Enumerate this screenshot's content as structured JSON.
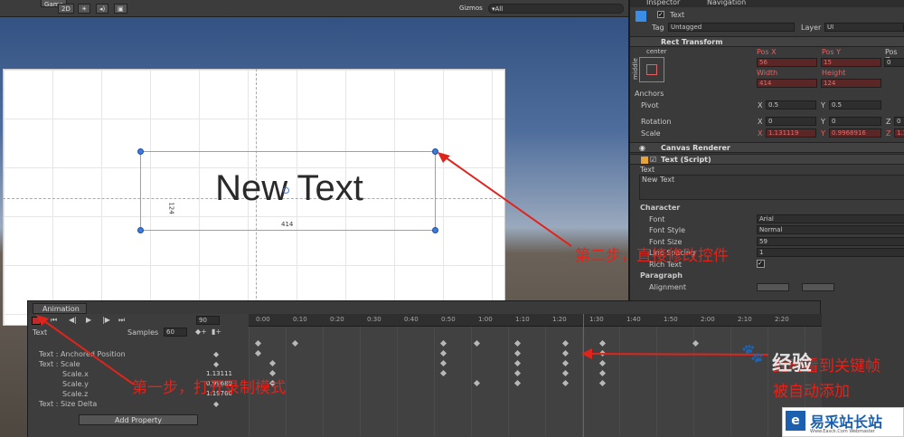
{
  "scene": {
    "tab": "Game",
    "mode": "2D",
    "gizmos": "Gizmos",
    "search": "▾All",
    "canvas_text": "New Text",
    "width_label": "414",
    "height_label": "124"
  },
  "inspector": {
    "tabs": [
      "Inspector",
      "Navigation"
    ],
    "object_name": "Text",
    "tag_label": "Tag",
    "tag": "Untagged",
    "layer_label": "Layer",
    "layer": "UI",
    "rect": {
      "title": "Rect Transform",
      "anchor_h": "center",
      "anchor_v": "middle",
      "pos_x_label": "Pos X",
      "pos_y_label": "Pos Y",
      "pos_z_label": "Pos Z",
      "pos_x": "56",
      "pos_y": "15",
      "pos_z": "0",
      "width_label": "Width",
      "height_label": "Height",
      "width": "414",
      "height": "124",
      "anchors": "Anchors",
      "pivot": "Pivot",
      "pivot_x": "0.5",
      "pivot_y": "0.5",
      "rotation": "Rotation",
      "rot_x": "0",
      "rot_y": "0",
      "rot_z": "0",
      "scale": "Scale",
      "scale_x": "1.131119",
      "scale_y": "0.9968916",
      "scale_z": "1.1"
    },
    "canvas_renderer": "Canvas Renderer",
    "text_script": {
      "title": "Text (Script)",
      "text_label": "Text",
      "text_value": "New Text",
      "character": "Character",
      "font": "Font",
      "font_value": "Arial",
      "font_style": "Font Style",
      "font_style_value": "Normal",
      "font_size": "Font Size",
      "font_size_value": "59",
      "line_spacing": "Line Spacing",
      "line_spacing_value": "1",
      "rich_text": "Rich Text",
      "paragraph": "Paragraph",
      "alignment": "Alignment"
    }
  },
  "animation": {
    "tab": "Animation",
    "frame": "90",
    "clip": "Text",
    "samples_label": "Samples",
    "samples": "60",
    "ticks": [
      "0:00",
      "0:10",
      "0:20",
      "0:30",
      "0:40",
      "0:50",
      "1:00",
      "1:10",
      "1:20",
      "1:30",
      "1:40",
      "1:50",
      "2:00",
      "2:10",
      "2:20"
    ],
    "properties": [
      {
        "name": "Text : Anchored Position",
        "value": ""
      },
      {
        "name": "Text : Scale",
        "value": ""
      },
      {
        "name": "Scale.x",
        "value": "1.13111"
      },
      {
        "name": "Scale.y",
        "value": "0.99689"
      },
      {
        "name": "Scale.z",
        "value": "1.19760"
      },
      {
        "name": "Text : Size Delta",
        "value": ""
      }
    ],
    "add_property": "Add Property"
  },
  "annotations": {
    "step1": "第一步，打开录制模式",
    "step2": "第二步，直接修改控件",
    "step3a": "此时看到关键帧",
    "step3b": "被自动添加"
  },
  "watermark": {
    "site": "易采站长站",
    "sub": "Www.Easck.Com Webmaster",
    "baidu": "经验"
  }
}
